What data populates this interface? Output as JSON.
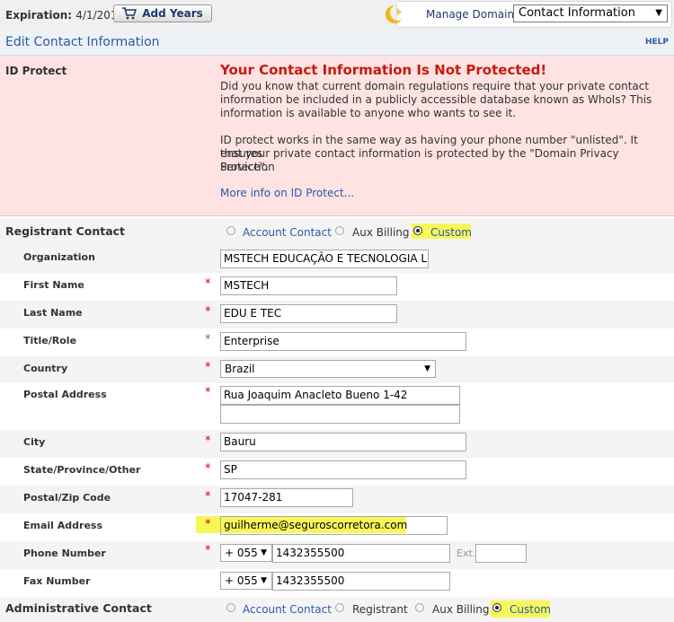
{
  "header": {
    "expiration_label": "Expiration:",
    "expiration_value": "4/1/2018",
    "add_years_label": "Add Years",
    "manage_domain_label": "Manage Domain:",
    "manage_domain_selected": "Contact Information"
  },
  "titlebar": {
    "title": "Edit Contact Information",
    "help": "HELP"
  },
  "id_protect": {
    "label": "ID Protect",
    "warning_title": "Your Contact Information Is Not Protected!",
    "para1_line1": "Did you know that current domain regulations require that your private contact",
    "para1_line2": "information be included in a publicly accessible database known as WhoIs? This",
    "para1_line3": "information is available to anyone who wants to see it.",
    "para2_line1": "ID protect works in the same way as having your phone number \"unlisted\". It ensures",
    "para2_line2": "that your private contact information is protected by the \"Domain Privacy Protection",
    "para2_line3": "Service\".",
    "more_info_link": "More info on ID Protect..."
  },
  "registrant": {
    "label": "Registrant Contact",
    "options": [
      "Account Contact",
      "Aux Billing",
      "Custom"
    ],
    "selected": "Custom"
  },
  "fields": {
    "organization": {
      "label": "Organization",
      "value": "MSTECH EDUCAÇÃO E TECNOLOGIA L"
    },
    "first_name": {
      "label": "First Name",
      "value": "MSTECH"
    },
    "last_name": {
      "label": "Last Name",
      "value": "EDU E TEC"
    },
    "title_role": {
      "label": "Title/Role",
      "value": "Enterprise"
    },
    "country": {
      "label": "Country",
      "value": "Brazil"
    },
    "postal_address": {
      "label": "Postal Address",
      "value1": "Rua Joaquim Anacleto Bueno 1-42",
      "value2": ""
    },
    "city": {
      "label": "City",
      "value": "Bauru"
    },
    "state": {
      "label": "State/Province/Other",
      "value": "SP"
    },
    "zip": {
      "label": "Postal/Zip Code",
      "value": "17047-281"
    },
    "email": {
      "label": "Email Address",
      "value": "guilherme@seguroscorretora.com"
    },
    "phone": {
      "label": "Phone Number",
      "country_code": "+ 055",
      "value": "1432355500",
      "ext_label": "Ext.",
      "ext_value": ""
    },
    "fax": {
      "label": "Fax Number",
      "country_code": "+ 055",
      "value": "1432355500"
    }
  },
  "administrative": {
    "label": "Administrative Contact",
    "options": [
      "Account Contact",
      "Registrant",
      "Aux Billing",
      "Custom"
    ],
    "selected": "Custom"
  },
  "required_marker": "*",
  "colors": {
    "accent": "#2a5aa8",
    "warning": "#c8190b",
    "highlight": "#f7f75a",
    "required": "#cc0000",
    "optional": "#1a9e1a"
  }
}
